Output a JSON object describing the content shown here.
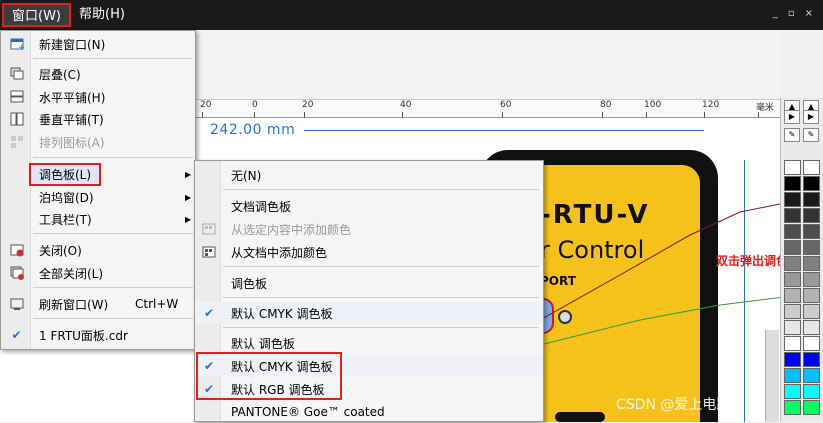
{
  "menubar": {
    "items": [
      {
        "label": "窗口(W)"
      },
      {
        "label": "帮助(H)"
      }
    ],
    "window_controls": [
      "_",
      "▫",
      "×"
    ]
  },
  "ruler": {
    "ticks": [
      "20",
      "0",
      "20",
      "40",
      "60",
      "80",
      "100",
      "120"
    ],
    "unit": "毫米"
  },
  "dimension": "242.00 mm",
  "artwork": {
    "brand": "-RTU-V",
    "subtitle": "r Control",
    "port": "PORT"
  },
  "annotation": "双击弹出调色板",
  "watermark": "CSDN @爱上电路设计",
  "window_menu": {
    "items": [
      {
        "label": "新建窗口(N)",
        "icon": "new-window-icon"
      },
      {
        "label": "层叠(C)",
        "icon": "cascade-icon"
      },
      {
        "label": "水平平铺(H)",
        "icon": "tile-horizontal-icon"
      },
      {
        "label": "垂直平铺(T)",
        "icon": "tile-vertical-icon"
      },
      {
        "label": "排列图标(A)",
        "icon": "arrange-icons-icon"
      },
      {
        "label": "调色板(L)"
      },
      {
        "label": "泊坞窗(D)"
      },
      {
        "label": "工具栏(T)"
      },
      {
        "label": "关闭(O)",
        "icon": "close-window-icon"
      },
      {
        "label": "全部关闭(L)",
        "icon": "close-all-icon"
      },
      {
        "label": "刷新窗口(W)",
        "shortcut": "Ctrl+W",
        "icon": "refresh-window-icon"
      },
      {
        "label": "1 FRTU面板.cdr",
        "icon": "check-icon"
      }
    ]
  },
  "palette_menu": {
    "items": [
      {
        "label": "无(N)"
      },
      {
        "label": "文档调色板"
      },
      {
        "label": "从选定内容中添加颜色"
      },
      {
        "label": "从文档中添加颜色"
      },
      {
        "label": "调色板"
      },
      {
        "label": "默认 CMYK 调色板"
      },
      {
        "label": "默认 调色板"
      },
      {
        "label": "默认 CMYK 调色板"
      },
      {
        "label": "默认 RGB 调色板"
      },
      {
        "label": "PANTONE® Goe™ coated"
      }
    ]
  },
  "colors": {
    "accent_red": "#e02020",
    "panel_yellow": "#f4c21a",
    "measure_blue": "#2b6fd6",
    "swatches": [
      "#ffffff",
      "#000000",
      "#1a1a1a",
      "#333333",
      "#4d4d4d",
      "#666666",
      "#808080",
      "#999999",
      "#b3b3b3",
      "#cccccc",
      "#e6e6e6",
      "#ffffff",
      "#0000ff",
      "#00bfff",
      "#00ffff",
      "#00ff66"
    ]
  }
}
